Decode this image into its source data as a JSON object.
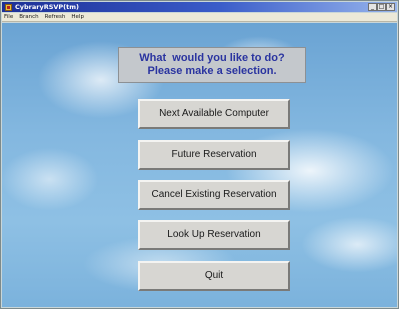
{
  "window": {
    "title": "CybraryRSVP(tm)",
    "controls": {
      "minimize": "_",
      "maximize": "□",
      "close": "×"
    }
  },
  "menubar": {
    "items": [
      {
        "label": "File"
      },
      {
        "label": "Branch"
      },
      {
        "label": "Refresh"
      },
      {
        "label": "Help"
      }
    ]
  },
  "main": {
    "prompt": {
      "line1": "What  would you like to do?",
      "line2": "Please make a selection."
    },
    "buttons": [
      {
        "label": "Next Available Computer"
      },
      {
        "label": "Future Reservation"
      },
      {
        "label": "Cancel Existing Reservation"
      },
      {
        "label": "Look Up Reservation"
      },
      {
        "label": "Quit"
      }
    ]
  },
  "colors": {
    "titlebar": "#1c2f96",
    "prompt_text": "#2a34a0",
    "sky": "#84b8e0"
  }
}
